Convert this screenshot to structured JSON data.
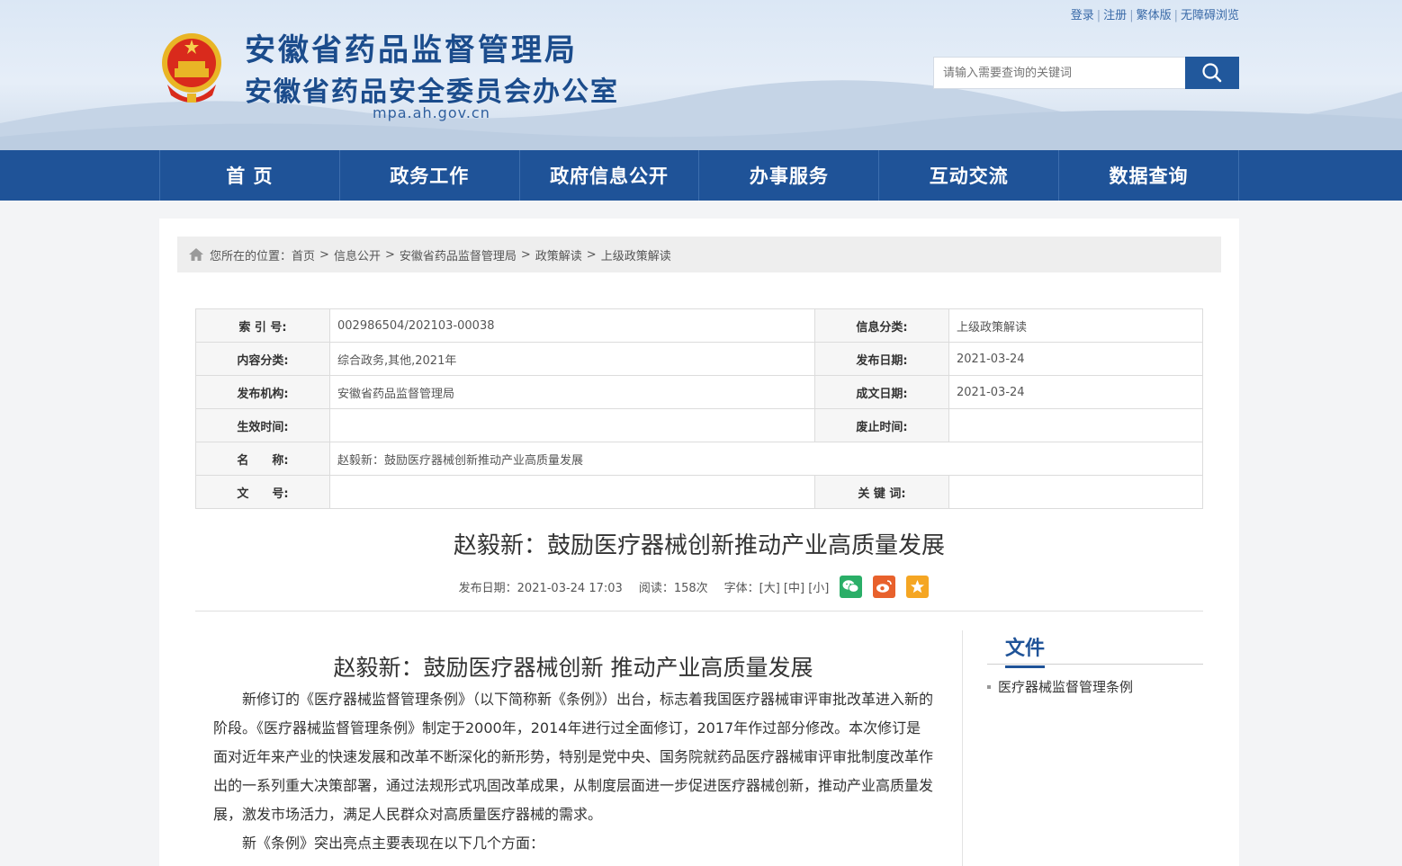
{
  "header": {
    "title_main": "安徽省药品监督管理局",
    "title_sub": "安徽省药品安全委员会办公室",
    "domain": "mpa.ah.gov.cn",
    "links": [
      "登录",
      "注册",
      "繁体版",
      "无障碍浏览"
    ],
    "search_placeholder": "请输入需要查询的关键词"
  },
  "nav": [
    "首 页",
    "政务工作",
    "政府信息公开",
    "办事服务",
    "互动交流",
    "数据查询"
  ],
  "breadcrumb": {
    "prefix": "您所在的位置：",
    "items": [
      "首页",
      "信息公开",
      "安徽省药品监督管理局",
      "政策解读",
      "上级政策解读"
    ]
  },
  "meta": {
    "index_label": "索 引 号:",
    "index_value": "002986504/202103-00038",
    "info_cat_label": "信息分类:",
    "info_cat_value": "上级政策解读",
    "content_cat_label": "内容分类:",
    "content_cat_value": "综合政务,其他,2021年",
    "pub_date_label": "发布日期:",
    "pub_date_value": "2021-03-24",
    "org_label": "发布机构:",
    "org_value": "安徽省药品监督管理局",
    "made_date_label": "成文日期:",
    "made_date_value": "2021-03-24",
    "effective_label": "生效时间:",
    "effective_value": "",
    "expire_label": "废止时间:",
    "expire_value": "",
    "name_label": "名　　称:",
    "name_value": "赵毅新：鼓励医疗器械创新推动产业高质量发展",
    "docno_label": "文　　号:",
    "docno_value": "",
    "keyword_label": "关 键 词:",
    "keyword_value": ""
  },
  "article": {
    "title": "赵毅新：鼓励医疗器械创新推动产业高质量发展",
    "date": "发布日期：2021-03-24 17:03",
    "reads": "阅读：158次",
    "font_size": "字体：[大] [中] [小]",
    "body_title": "赵毅新：鼓励医疗器械创新 推动产业高质量发展",
    "para1": "新修订的《医疗器械监督管理条例》（以下简称新《条例》）出台，标志着我国医疗器械审评审批改革进入新的阶段。《医疗器械监督管理条例》制定于2000年，2014年进行过全面修订，2017年作过部分修改。本次修订是面对近年来产业的快速发展和改革不断深化的新形势，特别是党中央、国务院就药品医疗器械审评审批制度改革作出的一系列重大决策部署，通过法规形式巩固改革成果，从制度层面进一步促进医疗器械创新，推动产业高质量发展，激发市场活力，满足人民群众对高质量医疗器械的需求。",
    "para2": "新《条例》突出亮点主要表现在以下几个方面："
  },
  "sidebar": {
    "title": "文件",
    "item": "医疗器械监督管理条例"
  },
  "colors": {
    "primary": "#1f5398",
    "wechat": "#2aae67",
    "weibo": "#e8612c",
    "fav": "#f5a623"
  }
}
